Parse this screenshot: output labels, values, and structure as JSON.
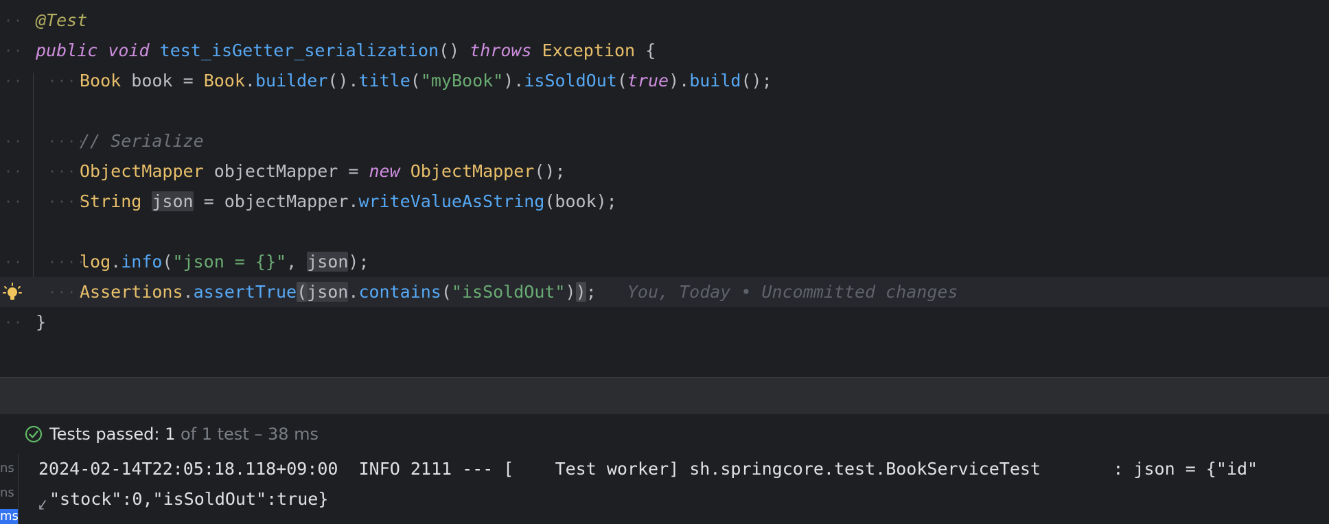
{
  "editor": {
    "lines": {
      "l1": {
        "ann": "@Test"
      },
      "l2": {
        "kw1": "public",
        "kw2": "void",
        "fn": "test_isGetter_serialization",
        "paren": "()",
        "kw3": "throws",
        "cls": "Exception",
        "brace": "{"
      },
      "l3": {
        "cls1": "Book",
        "var": "book",
        "eq": "=",
        "cls2": "Book",
        "dot1": ".",
        "fn1": "builder",
        "p1": "().",
        "fn2": "title",
        "p2": "(",
        "str": "\"myBook\"",
        "p3": ").",
        "fn3": "isSoldOut",
        "p4": "(",
        "kw": "true",
        "p5": ").",
        "fn4": "build",
        "p6": "();"
      },
      "l5": {
        "cmt": "// Serialize"
      },
      "l6": {
        "cls1": "ObjectMapper",
        "var": "objectMapper",
        "eq": "=",
        "kw": "new",
        "cls2": "ObjectMapper",
        "p": "();"
      },
      "l7": {
        "cls": "String",
        "var": "json",
        "eq": "= objectMapper.",
        "fn": "writeValueAsString",
        "p": "(book);"
      },
      "l9": {
        "field": "log",
        "dot": ".",
        "fn": "info",
        "p1": "(",
        "str": "\"json = {}\"",
        "p2": ", ",
        "var": "json",
        "p3": ");"
      },
      "l10": {
        "cls": "Assertions",
        "dot1": ".",
        "fn1": "assertTrue",
        "p1": "(",
        "var": "json",
        "dot2": ".",
        "fn2": "contains",
        "p2": "(",
        "str": "\"isSoldOut\"",
        "p3": ")",
        "p4": ")",
        "p5": ";",
        "blame": "You, Today • Uncommitted changes"
      },
      "l11": {
        "brace": "}"
      }
    }
  },
  "test_status": {
    "passed_label": "Tests passed: ",
    "passed_count": "1",
    "rest": " of 1 test – 38 ms"
  },
  "console": {
    "gutter_labels": [
      "ns",
      "ns",
      "ms"
    ],
    "line1": "2024-02-14T22:05:18.118+09:00  INFO 2111 --- [    Test worker] sh.springcore.test.BookServiceTest       : json = {\"id\"",
    "line2": "\"stock\":0,\"isSoldOut\":true}"
  },
  "colors": {
    "background": "#1e1f22",
    "success": "#5fb865",
    "bulb": "#f2c55c"
  }
}
